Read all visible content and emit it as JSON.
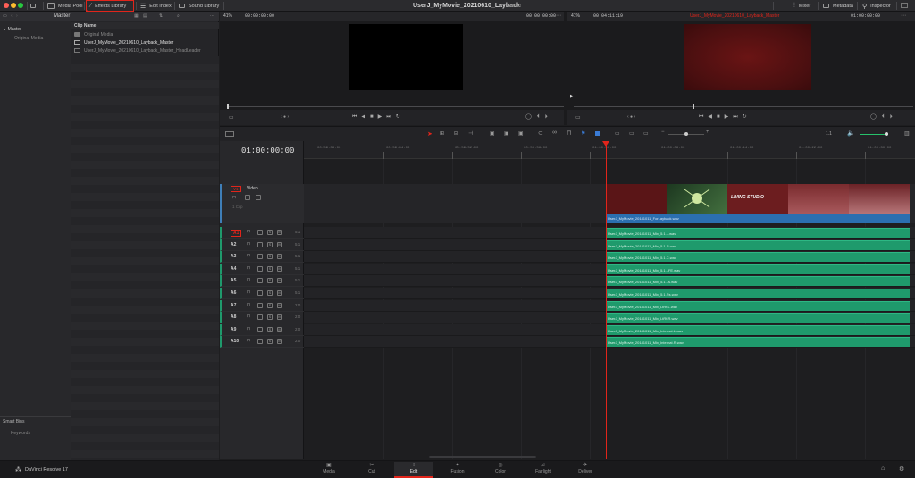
{
  "topbar": {
    "media_pool": "Media Pool",
    "effects_library": "Effects Library",
    "edit_index": "Edit Index",
    "sound_library": "Sound Library",
    "project_title": "UserJ_MyMovie_20210610_Layback",
    "project_status": "Edited",
    "mixer": "Mixer",
    "metadata": "Metadata",
    "inspector": "Inspector"
  },
  "media_pool": {
    "breadcrumb": "Master",
    "bins": [
      "Master",
      "Original Media"
    ],
    "column_header": "Clip Name",
    "clips": [
      "Original Media",
      "UserJ_MyMovie_20210610_Layback_Master",
      "UserJ_MyMovie_20210610_Layback_Master_HeadLeader"
    ],
    "smart_bins": "Smart Bins",
    "smart_bin_items": [
      "Keywords"
    ]
  },
  "source_viewer": {
    "zoom": "41%",
    "timecode_left": "00:00:00:00",
    "timecode_right": "00:00:00:00"
  },
  "timeline_viewer": {
    "zoom": "41%",
    "duration": "00:04:11:19",
    "timeline_name": "UserJ_MyMovie_20210610_Layback_Master",
    "timecode": "01:00:00:00"
  },
  "timeline": {
    "current_timecode": "01:00:00:00",
    "zoom_label": "1.1",
    "ruler": [
      "00:59:36:00",
      "00:59:44:00",
      "00:59:52:00",
      "00:59:56:00",
      "01:00:00:00",
      "01:00:06:00",
      "01:00:14:00",
      "01:00:22:00",
      "01:00:30:00"
    ],
    "video_track": {
      "id": "V1",
      "name": "Video",
      "clip_count": "1 Clip"
    },
    "video_clip_label": "UserJ_MyMovie_20181011_ForLayback.wav",
    "audio_tracks": [
      {
        "id": "A1",
        "channels": "5.1",
        "clip": "UserJ_MyMovie_20181011_Mix_5.1.L.wav"
      },
      {
        "id": "A2",
        "channels": "5.1",
        "clip": "UserJ_MyMovie_20181011_Mix_5.1.R.wav"
      },
      {
        "id": "A3",
        "channels": "5.1",
        "clip": "UserJ_MyMovie_20181011_Mix_5.1.C.wav"
      },
      {
        "id": "A4",
        "channels": "5.1",
        "clip": "UserJ_MyMovie_20181011_Mix_5.1.LFE.wav"
      },
      {
        "id": "A5",
        "channels": "5.1",
        "clip": "UserJ_MyMovie_20181011_Mix_5.1.Ls.wav"
      },
      {
        "id": "A6",
        "channels": "5.1",
        "clip": "UserJ_MyMovie_20181011_Mix_5.1.Rs.wav"
      },
      {
        "id": "A7",
        "channels": "2.0",
        "clip": "UserJ_MyMovie_20181011_Mix_LtRt.L.wav"
      },
      {
        "id": "A8",
        "channels": "2.0",
        "clip": "UserJ_MyMovie_20181011_Mix_LtRt.R.wav"
      },
      {
        "id": "A9",
        "channels": "2.0",
        "clip": "UserJ_MyMovie_20181011_Mix_Internat.L.wav"
      },
      {
        "id": "A10",
        "channels": "2.0",
        "clip": "UserJ_MyMovie_20181011_Mix_Internat.R.wav"
      }
    ],
    "solo_label": "S",
    "mute_label": "M"
  },
  "film_strip": {
    "text": "LIVING STUDIO"
  },
  "bottom": {
    "app_name": "DaVinci Resolve 17",
    "pages": [
      "Media",
      "Cut",
      "Edit",
      "Fusion",
      "Color",
      "Fairlight",
      "Deliver"
    ],
    "active_page": "Edit"
  },
  "colors": {
    "accent_red": "#e1251b",
    "audio_clip": "#1f9a6c",
    "video_audio_clip": "#2b6fb0",
    "playhead": "#e1251b"
  }
}
